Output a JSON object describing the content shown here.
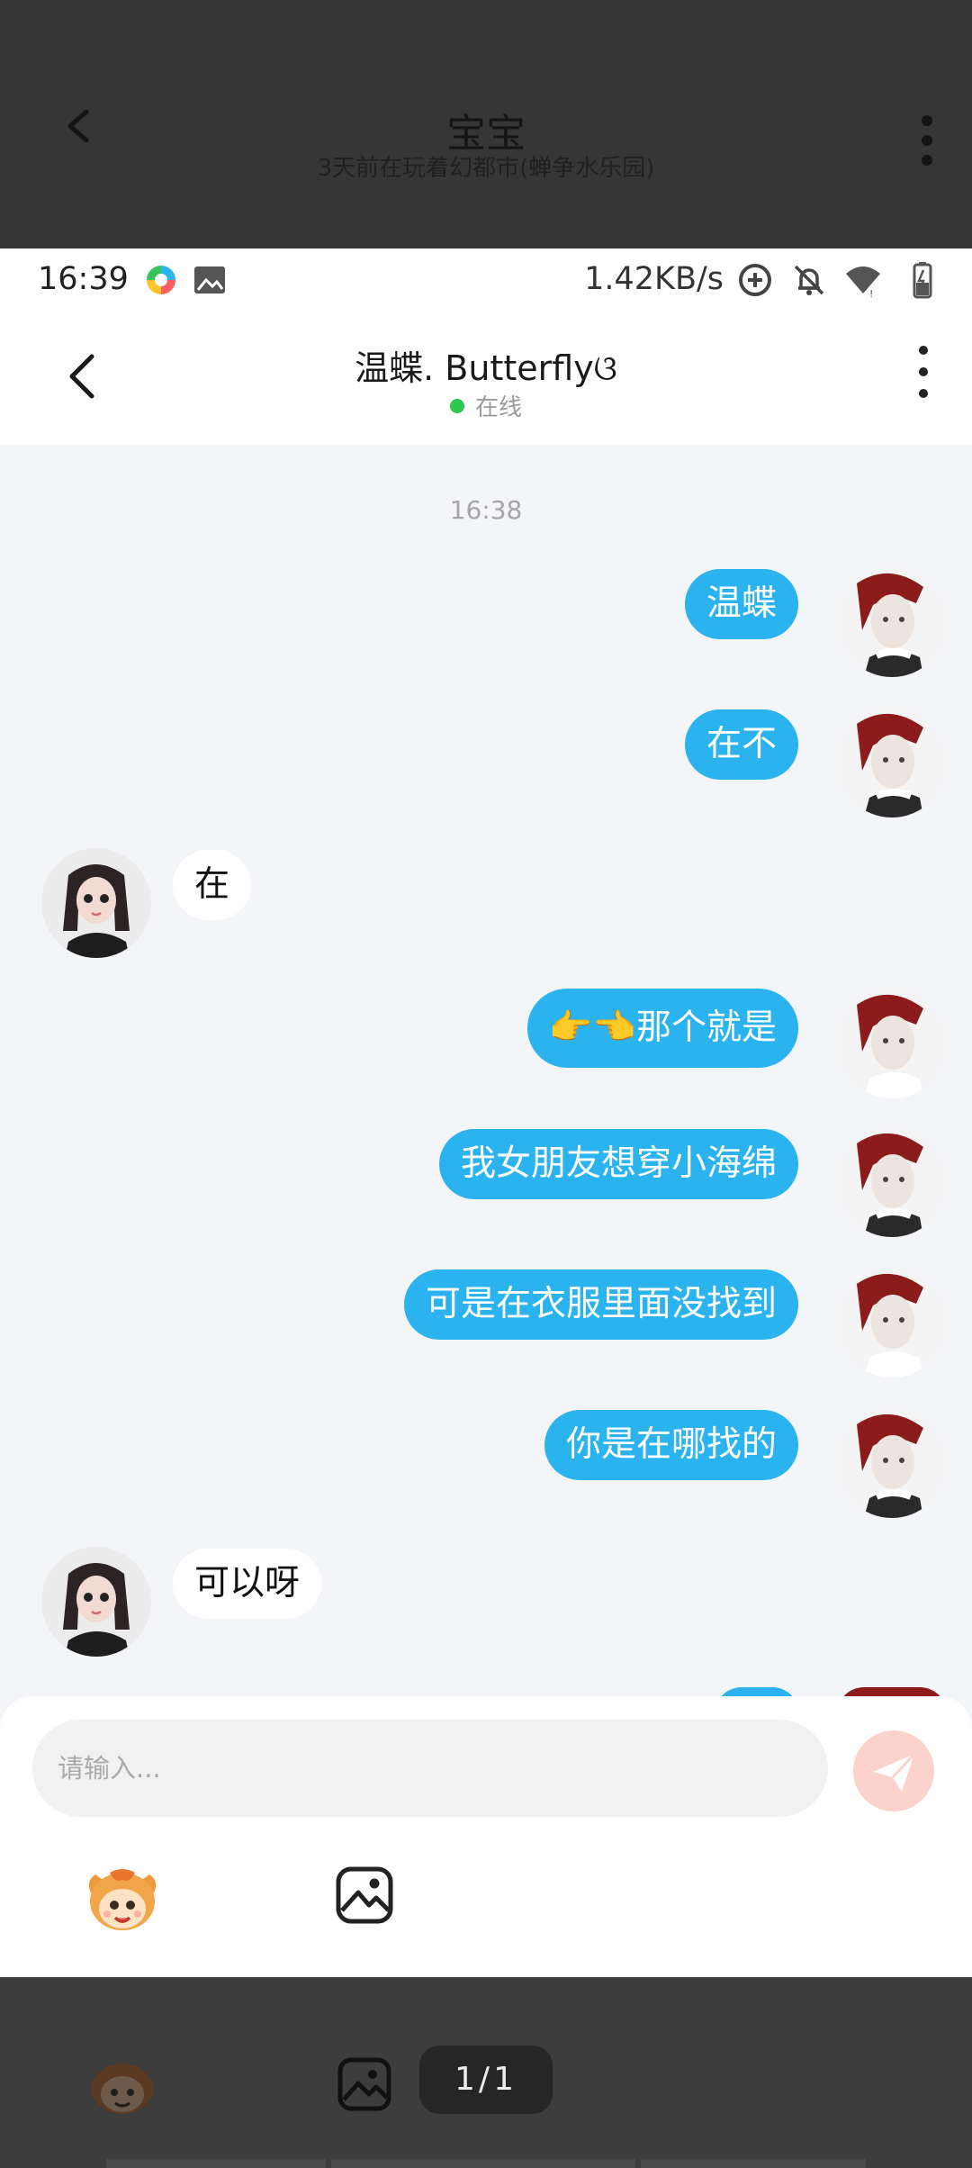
{
  "background_screen": {
    "title": "宝宝",
    "subtitle": "3天前在玩着幻都市(蝉争水乐园)",
    "page_indicator": "1/1"
  },
  "status_bar": {
    "time": "16:39",
    "network_speed": "1.42KB/s"
  },
  "chat_header": {
    "title": "温蝶. Butterflyଓ",
    "status": "在线",
    "status_color": "#2dc84d"
  },
  "timestamp": "16:38",
  "messages": [
    {
      "sender": "me",
      "text": "温蝶"
    },
    {
      "sender": "me",
      "text": "在不"
    },
    {
      "sender": "other",
      "text": "在"
    },
    {
      "sender": "me",
      "text": "👉👈那个就是"
    },
    {
      "sender": "me",
      "text": "我女朋友想穿小海绵"
    },
    {
      "sender": "me",
      "text": "可是在衣服里面没找到"
    },
    {
      "sender": "me",
      "text": "你是在哪找的"
    },
    {
      "sender": "other",
      "text": "可以呀"
    }
  ],
  "input": {
    "placeholder": "请输入..."
  },
  "colors": {
    "outgoing_bubble": "#2bb3ef",
    "incoming_bubble": "#ffffff",
    "chat_background": "#f3f5f8",
    "send_button": "#fbd3cc"
  }
}
